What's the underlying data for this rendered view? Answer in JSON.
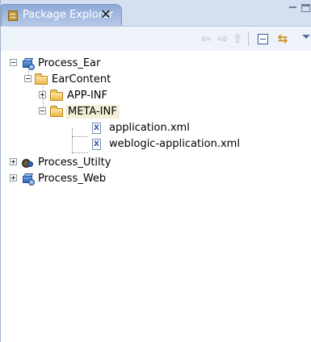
{
  "view": {
    "title": "Package Explorer",
    "close_glyph": "✕"
  },
  "toolbar": {
    "back_glyph": "⇦",
    "forward_glyph": "⇨",
    "up_glyph": "⇧",
    "link_glyph": "⇆"
  },
  "tree": {
    "process_ear": "Process_Ear",
    "earcontent": "EarContent",
    "app_inf": "APP-INF",
    "meta_inf": "META-INF",
    "application_xml": "application.xml",
    "weblogic_application_xml": "weblogic-application.xml",
    "process_utilty": "Process_Utilty",
    "process_web": "Process_Web"
  },
  "icons": {
    "tab": "package-explorer-icon",
    "project_ear": "ear-project-icon",
    "project_utility": "utility-project-icon",
    "project_web": "web-project-icon",
    "folder": "folder-icon",
    "xml": "xml-file-icon"
  },
  "colors": {
    "tab_active": "#8ea9d8",
    "selection": "#f4f0d8"
  }
}
